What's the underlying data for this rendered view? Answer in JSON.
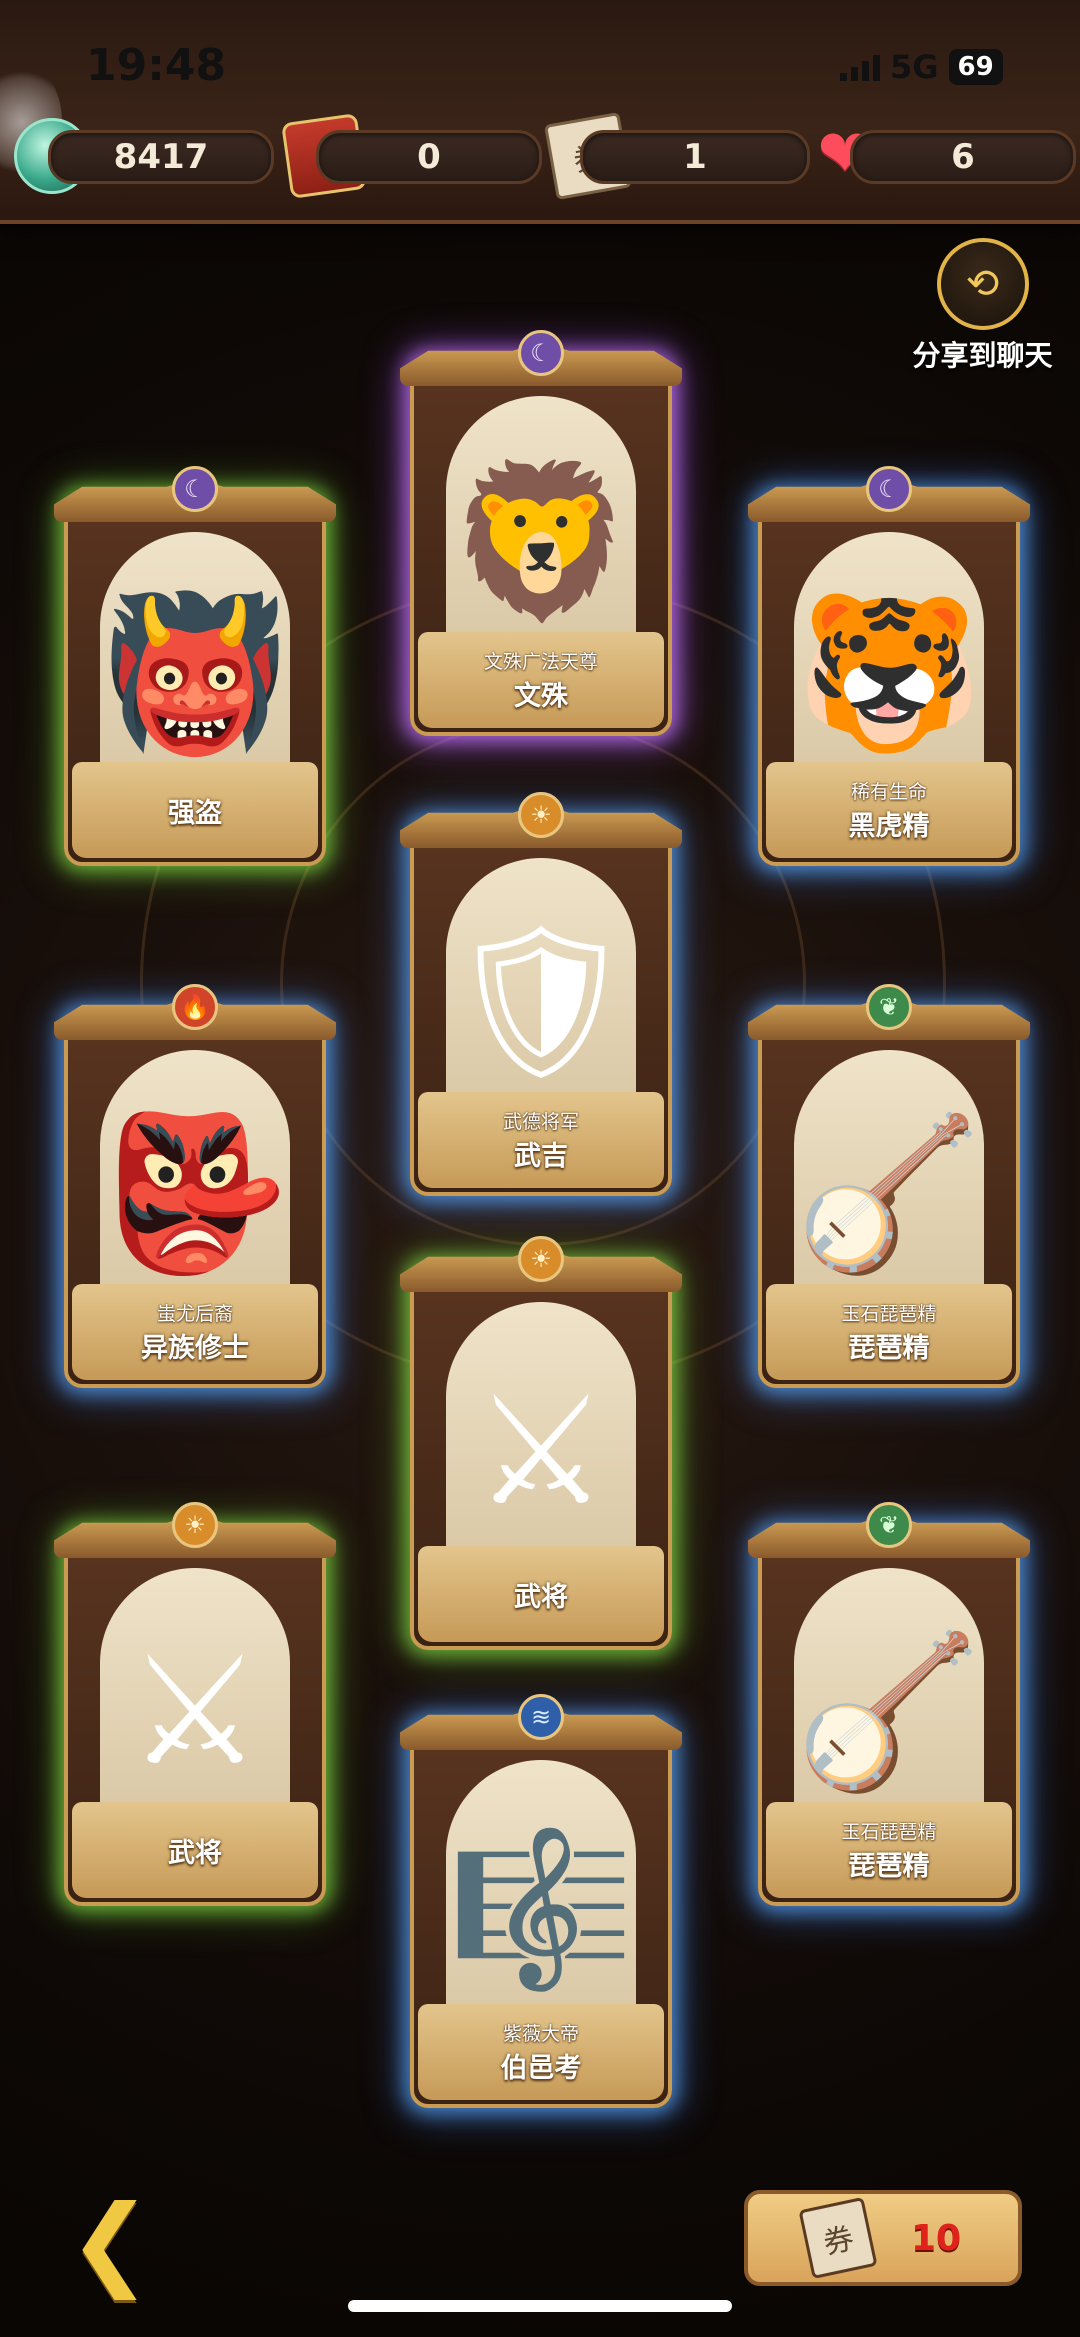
{
  "status": {
    "time": "19:48",
    "network": "5G",
    "battery": "69"
  },
  "currencies": [
    {
      "name": "gem",
      "icon": "jade-gem-icon",
      "value": "8417"
    },
    {
      "name": "pack",
      "icon": "red-gift-pack-icon",
      "value": "0"
    },
    {
      "name": "ticket",
      "icon": "ticket-icon",
      "value": "1"
    },
    {
      "name": "hearts",
      "icon": "heart-icon",
      "value": "6"
    }
  ],
  "share": {
    "label": "分享到聊天",
    "icon": "share-icon"
  },
  "cards": [
    {
      "title": "文殊广法天尊",
      "name": "文殊",
      "element": "moon",
      "glow": "purple"
    },
    {
      "title": "",
      "name": "强盗",
      "element": "moon",
      "glow": "green"
    },
    {
      "title": "稀有生命",
      "name": "黑虎精",
      "element": "moon",
      "glow": "blue"
    },
    {
      "title": "武德将军",
      "name": "武吉",
      "element": "sun",
      "glow": "blue"
    },
    {
      "title": "蚩尤后裔",
      "name": "异族修士",
      "element": "fire",
      "glow": "blue"
    },
    {
      "title": "玉石琵琶精",
      "name": "琵琶精",
      "element": "leaf",
      "glow": "blue"
    },
    {
      "title": "",
      "name": "武将",
      "element": "sun",
      "glow": "green"
    },
    {
      "title": "",
      "name": "武将",
      "element": "sun",
      "glow": "green"
    },
    {
      "title": "玉石琵琶精",
      "name": "琵琶精",
      "element": "leaf",
      "glow": "blue"
    },
    {
      "title": "紫薇大帝",
      "name": "伯邑考",
      "element": "water",
      "glow": "blue"
    }
  ],
  "draw_cost": {
    "icon": "ticket-icon",
    "value": "10"
  },
  "colors": {
    "accent_gold": "#e2b447",
    "cost_red": "#e0231a"
  }
}
